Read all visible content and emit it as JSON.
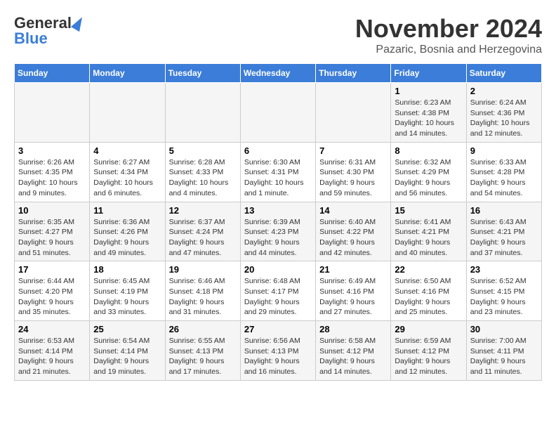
{
  "header": {
    "logo_line1": "General",
    "logo_line2": "Blue",
    "month": "November 2024",
    "location": "Pazaric, Bosnia and Herzegovina"
  },
  "weekdays": [
    "Sunday",
    "Monday",
    "Tuesday",
    "Wednesday",
    "Thursday",
    "Friday",
    "Saturday"
  ],
  "weeks": [
    [
      {
        "day": "",
        "info": ""
      },
      {
        "day": "",
        "info": ""
      },
      {
        "day": "",
        "info": ""
      },
      {
        "day": "",
        "info": ""
      },
      {
        "day": "",
        "info": ""
      },
      {
        "day": "1",
        "info": "Sunrise: 6:23 AM\nSunset: 4:38 PM\nDaylight: 10 hours and 14 minutes."
      },
      {
        "day": "2",
        "info": "Sunrise: 6:24 AM\nSunset: 4:36 PM\nDaylight: 10 hours and 12 minutes."
      }
    ],
    [
      {
        "day": "3",
        "info": "Sunrise: 6:26 AM\nSunset: 4:35 PM\nDaylight: 10 hours and 9 minutes."
      },
      {
        "day": "4",
        "info": "Sunrise: 6:27 AM\nSunset: 4:34 PM\nDaylight: 10 hours and 6 minutes."
      },
      {
        "day": "5",
        "info": "Sunrise: 6:28 AM\nSunset: 4:33 PM\nDaylight: 10 hours and 4 minutes."
      },
      {
        "day": "6",
        "info": "Sunrise: 6:30 AM\nSunset: 4:31 PM\nDaylight: 10 hours and 1 minute."
      },
      {
        "day": "7",
        "info": "Sunrise: 6:31 AM\nSunset: 4:30 PM\nDaylight: 9 hours and 59 minutes."
      },
      {
        "day": "8",
        "info": "Sunrise: 6:32 AM\nSunset: 4:29 PM\nDaylight: 9 hours and 56 minutes."
      },
      {
        "day": "9",
        "info": "Sunrise: 6:33 AM\nSunset: 4:28 PM\nDaylight: 9 hours and 54 minutes."
      }
    ],
    [
      {
        "day": "10",
        "info": "Sunrise: 6:35 AM\nSunset: 4:27 PM\nDaylight: 9 hours and 51 minutes."
      },
      {
        "day": "11",
        "info": "Sunrise: 6:36 AM\nSunset: 4:26 PM\nDaylight: 9 hours and 49 minutes."
      },
      {
        "day": "12",
        "info": "Sunrise: 6:37 AM\nSunset: 4:24 PM\nDaylight: 9 hours and 47 minutes."
      },
      {
        "day": "13",
        "info": "Sunrise: 6:39 AM\nSunset: 4:23 PM\nDaylight: 9 hours and 44 minutes."
      },
      {
        "day": "14",
        "info": "Sunrise: 6:40 AM\nSunset: 4:22 PM\nDaylight: 9 hours and 42 minutes."
      },
      {
        "day": "15",
        "info": "Sunrise: 6:41 AM\nSunset: 4:21 PM\nDaylight: 9 hours and 40 minutes."
      },
      {
        "day": "16",
        "info": "Sunrise: 6:43 AM\nSunset: 4:21 PM\nDaylight: 9 hours and 37 minutes."
      }
    ],
    [
      {
        "day": "17",
        "info": "Sunrise: 6:44 AM\nSunset: 4:20 PM\nDaylight: 9 hours and 35 minutes."
      },
      {
        "day": "18",
        "info": "Sunrise: 6:45 AM\nSunset: 4:19 PM\nDaylight: 9 hours and 33 minutes."
      },
      {
        "day": "19",
        "info": "Sunrise: 6:46 AM\nSunset: 4:18 PM\nDaylight: 9 hours and 31 minutes."
      },
      {
        "day": "20",
        "info": "Sunrise: 6:48 AM\nSunset: 4:17 PM\nDaylight: 9 hours and 29 minutes."
      },
      {
        "day": "21",
        "info": "Sunrise: 6:49 AM\nSunset: 4:16 PM\nDaylight: 9 hours and 27 minutes."
      },
      {
        "day": "22",
        "info": "Sunrise: 6:50 AM\nSunset: 4:16 PM\nDaylight: 9 hours and 25 minutes."
      },
      {
        "day": "23",
        "info": "Sunrise: 6:52 AM\nSunset: 4:15 PM\nDaylight: 9 hours and 23 minutes."
      }
    ],
    [
      {
        "day": "24",
        "info": "Sunrise: 6:53 AM\nSunset: 4:14 PM\nDaylight: 9 hours and 21 minutes."
      },
      {
        "day": "25",
        "info": "Sunrise: 6:54 AM\nSunset: 4:14 PM\nDaylight: 9 hours and 19 minutes."
      },
      {
        "day": "26",
        "info": "Sunrise: 6:55 AM\nSunset: 4:13 PM\nDaylight: 9 hours and 17 minutes."
      },
      {
        "day": "27",
        "info": "Sunrise: 6:56 AM\nSunset: 4:13 PM\nDaylight: 9 hours and 16 minutes."
      },
      {
        "day": "28",
        "info": "Sunrise: 6:58 AM\nSunset: 4:12 PM\nDaylight: 9 hours and 14 minutes."
      },
      {
        "day": "29",
        "info": "Sunrise: 6:59 AM\nSunset: 4:12 PM\nDaylight: 9 hours and 12 minutes."
      },
      {
        "day": "30",
        "info": "Sunrise: 7:00 AM\nSunset: 4:11 PM\nDaylight: 9 hours and 11 minutes."
      }
    ]
  ]
}
